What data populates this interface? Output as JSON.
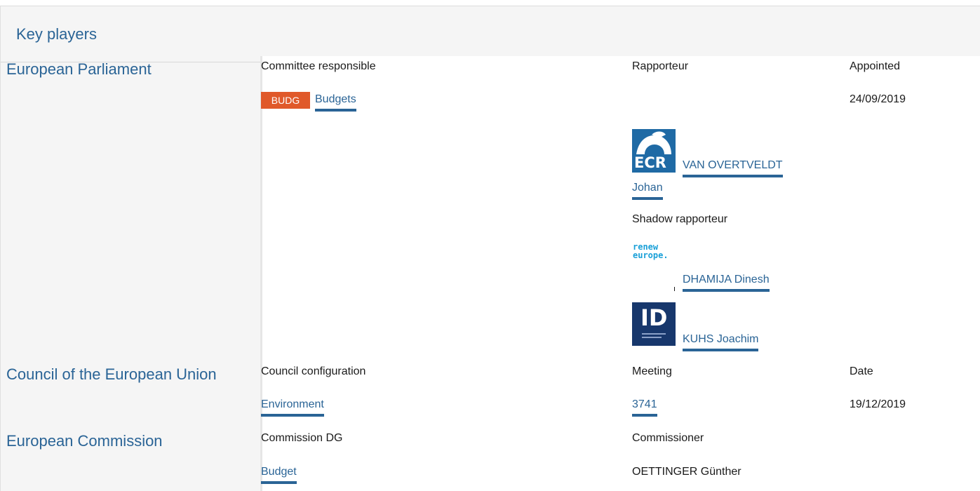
{
  "panel": {
    "title": "Key players"
  },
  "parliament": {
    "name": "European Parliament",
    "committee_header": "Committee responsible",
    "rapporteur_header": "Rapporteur",
    "appointed_header": "Appointed",
    "committee_badge": "BUDG",
    "committee_name": "Budgets",
    "appointed_date": "24/09/2019",
    "rapporteur": {
      "group_logo": "ECR",
      "name_line1": "VAN OVERTVELDT",
      "name_line2": "Johan"
    },
    "shadow_header": "Shadow rapporteur",
    "shadows": [
      {
        "group_logo_line1": "renew",
        "group_logo_line2": "europe.",
        "name": "DHAMIJA Dinesh"
      },
      {
        "group_logo": "ID",
        "name": "KUHS Joachim"
      }
    ]
  },
  "council": {
    "name": "Council of the European Union",
    "config_header": "Council configuration",
    "meeting_header": "Meeting",
    "date_header": "Date",
    "config": "Environment",
    "meeting": "3741",
    "date": "19/12/2019"
  },
  "commission": {
    "name": "European Commission",
    "dg_header": "Commission DG",
    "commissioner_header": "Commissioner",
    "dg": "Budget",
    "commissioner": "OETTINGER Günther"
  },
  "colors": {
    "link": "#2a6496",
    "badge": "#e0592a",
    "ecr": "#1f6aa5",
    "id": "#17376c",
    "renew": "#1aa0d8"
  }
}
